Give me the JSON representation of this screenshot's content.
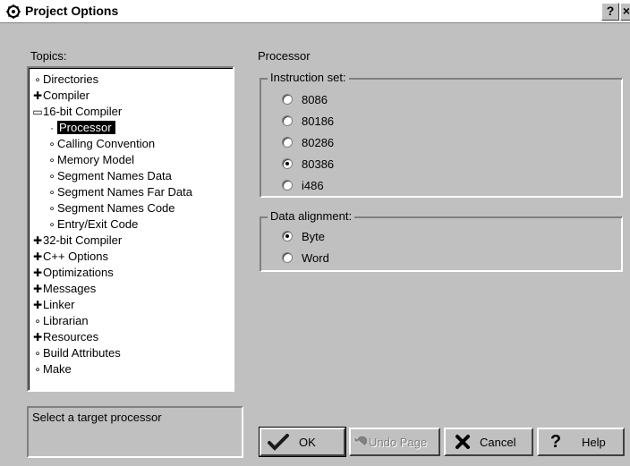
{
  "window": {
    "title": "Project Options",
    "help_btn": "?",
    "close_btn": "×"
  },
  "topics": {
    "label": "Topics:",
    "items": [
      {
        "label": "Directories",
        "glyph": "∘",
        "indent": 0,
        "selected": false
      },
      {
        "label": "Compiler",
        "glyph": "✚",
        "indent": 0,
        "selected": false
      },
      {
        "label": "16-bit Compiler",
        "glyph": "▭",
        "indent": 0,
        "selected": false
      },
      {
        "label": "Processor",
        "glyph": "·",
        "indent": 1,
        "selected": true
      },
      {
        "label": "Calling Convention",
        "glyph": "∘",
        "indent": 1,
        "selected": false
      },
      {
        "label": "Memory Model",
        "glyph": "∘",
        "indent": 1,
        "selected": false
      },
      {
        "label": "Segment Names Data",
        "glyph": "∘",
        "indent": 1,
        "selected": false
      },
      {
        "label": "Segment Names Far Data",
        "glyph": "∘",
        "indent": 1,
        "selected": false
      },
      {
        "label": "Segment Names Code",
        "glyph": "∘",
        "indent": 1,
        "selected": false
      },
      {
        "label": "Entry/Exit Code",
        "glyph": "∘",
        "indent": 1,
        "selected": false
      },
      {
        "label": "32-bit Compiler",
        "glyph": "✚",
        "indent": 0,
        "selected": false
      },
      {
        "label": "C++ Options",
        "glyph": "✚",
        "indent": 0,
        "selected": false
      },
      {
        "label": "Optimizations",
        "glyph": "✚",
        "indent": 0,
        "selected": false
      },
      {
        "label": "Messages",
        "glyph": "✚",
        "indent": 0,
        "selected": false
      },
      {
        "label": "Linker",
        "glyph": "✚",
        "indent": 0,
        "selected": false
      },
      {
        "label": "Librarian",
        "glyph": "∘",
        "indent": 0,
        "selected": false
      },
      {
        "label": "Resources",
        "glyph": "✚",
        "indent": 0,
        "selected": false
      },
      {
        "label": "Build Attributes",
        "glyph": "∘",
        "indent": 0,
        "selected": false
      },
      {
        "label": "Make",
        "glyph": "∘",
        "indent": 0,
        "selected": false
      }
    ]
  },
  "status_text": "Select a target processor",
  "page_title": "Processor",
  "instruction_set": {
    "legend": "Instruction set:",
    "options": [
      "8086",
      "80186",
      "80286",
      "80386",
      "i486"
    ],
    "selected_index": 3
  },
  "data_alignment": {
    "legend": "Data alignment:",
    "options": [
      "Byte",
      "Word"
    ],
    "selected_index": 0
  },
  "buttons": {
    "ok": "OK",
    "undo": "Undo Page",
    "cancel": "Cancel",
    "help": "Help"
  }
}
